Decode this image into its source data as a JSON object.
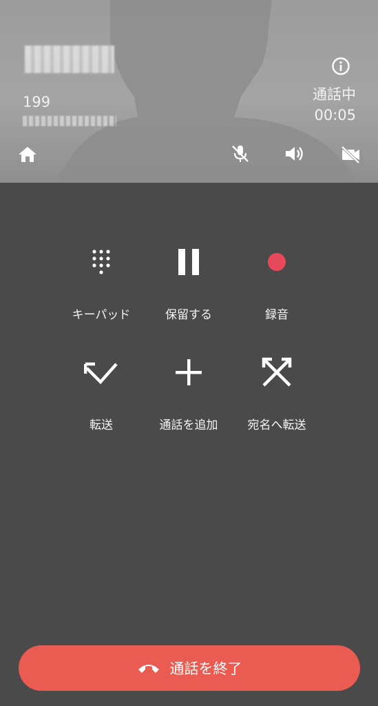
{
  "caller": {
    "number": "199",
    "status": "通話中",
    "duration": "00:05"
  },
  "actions": [
    {
      "id": "keypad",
      "label": "キーパッド",
      "icon": "dialpad-icon"
    },
    {
      "id": "hold",
      "label": "保留する",
      "icon": "pause-icon"
    },
    {
      "id": "record",
      "label": "録音",
      "icon": "record-icon"
    },
    {
      "id": "transfer",
      "label": "転送",
      "icon": "transfer-icon"
    },
    {
      "id": "add",
      "label": "通話を追加",
      "icon": "plus-icon"
    },
    {
      "id": "direct",
      "label": "宛名へ転送",
      "icon": "direct-transfer-icon"
    }
  ],
  "end_call": {
    "label": "通話を終了",
    "icon": "hangup-icon"
  },
  "colors": {
    "background": "#4a4a4a",
    "header": "#a0a0a0",
    "end": "#ea5b52",
    "record": "#e8495a"
  }
}
